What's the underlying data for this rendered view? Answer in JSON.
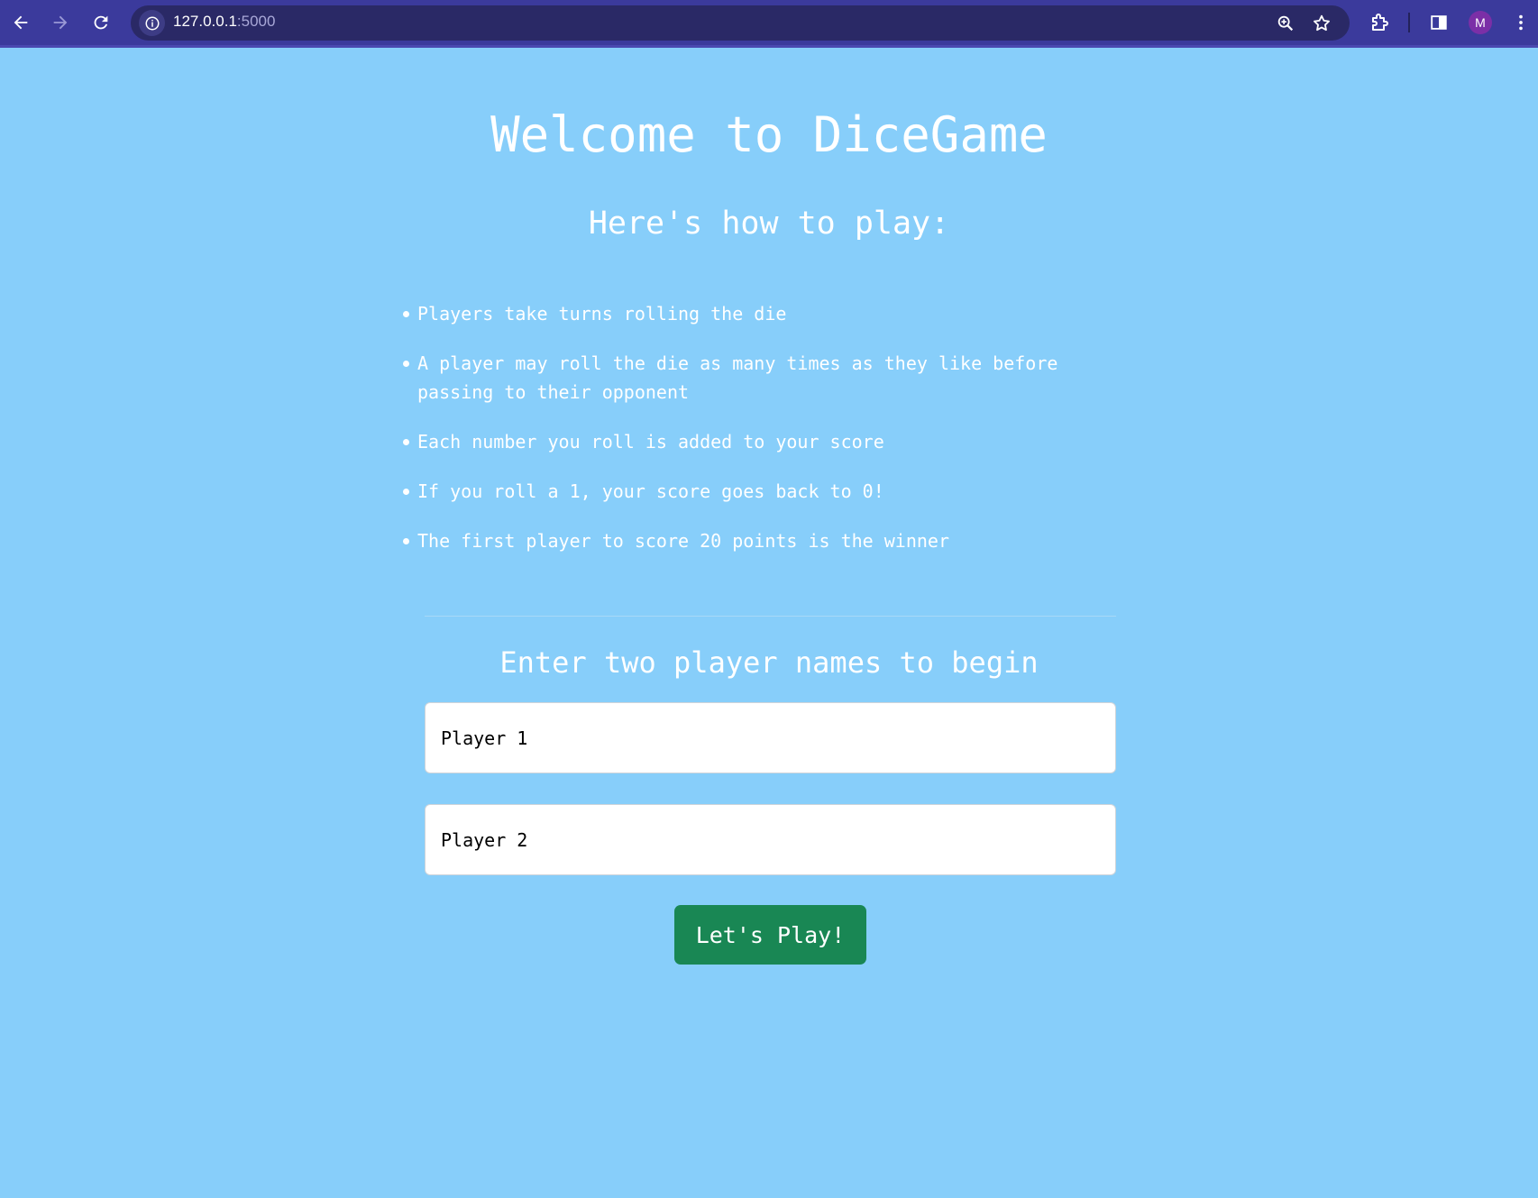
{
  "browser": {
    "url_host": "127.0.0.1",
    "url_port": ":5000",
    "profile_initial": "M",
    "icons": [
      "back-arrow-icon",
      "forward-arrow-icon",
      "reload-icon",
      "site-info-icon",
      "zoom-icon",
      "bookmark-star-icon",
      "extensions-icon",
      "side-panel-icon",
      "more-menu-icon"
    ]
  },
  "page": {
    "title": "Welcome to DiceGame",
    "subtitle": "Here's how to play:",
    "rules": [
      "Players take turns rolling the die",
      "A player may roll the die as many times as they like before passing to their opponent",
      "Each number you roll is added to your score",
      "If you roll a 1, your score goes back to 0!",
      "The first player to score 20 points is the winner"
    ],
    "form": {
      "heading": "Enter two player names to begin",
      "player1_placeholder": "Player 1",
      "player1_value": "",
      "player2_placeholder": "Player 2",
      "player2_value": "",
      "submit_label": "Let's Play!"
    }
  },
  "colors": {
    "background": "#87cefa",
    "browser_toolbar": "#3b3a9c",
    "button": "#198754",
    "text": "#ffffff"
  }
}
